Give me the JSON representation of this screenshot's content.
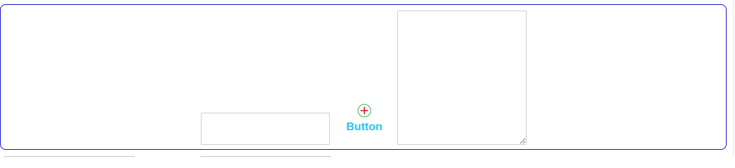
{
  "form": {
    "text_input": {
      "value": "",
      "placeholder": ""
    },
    "add_button": {
      "label": "Button",
      "icon": "circle-plus-icon"
    },
    "textarea": {
      "value": "",
      "placeholder": ""
    }
  },
  "colors": {
    "frame_border": "#1a14c8",
    "button_label": "#22c6ee",
    "icon_circle": "#3cb54a",
    "icon_plus": "#d6202a",
    "field_border": "#cfcfcf"
  }
}
